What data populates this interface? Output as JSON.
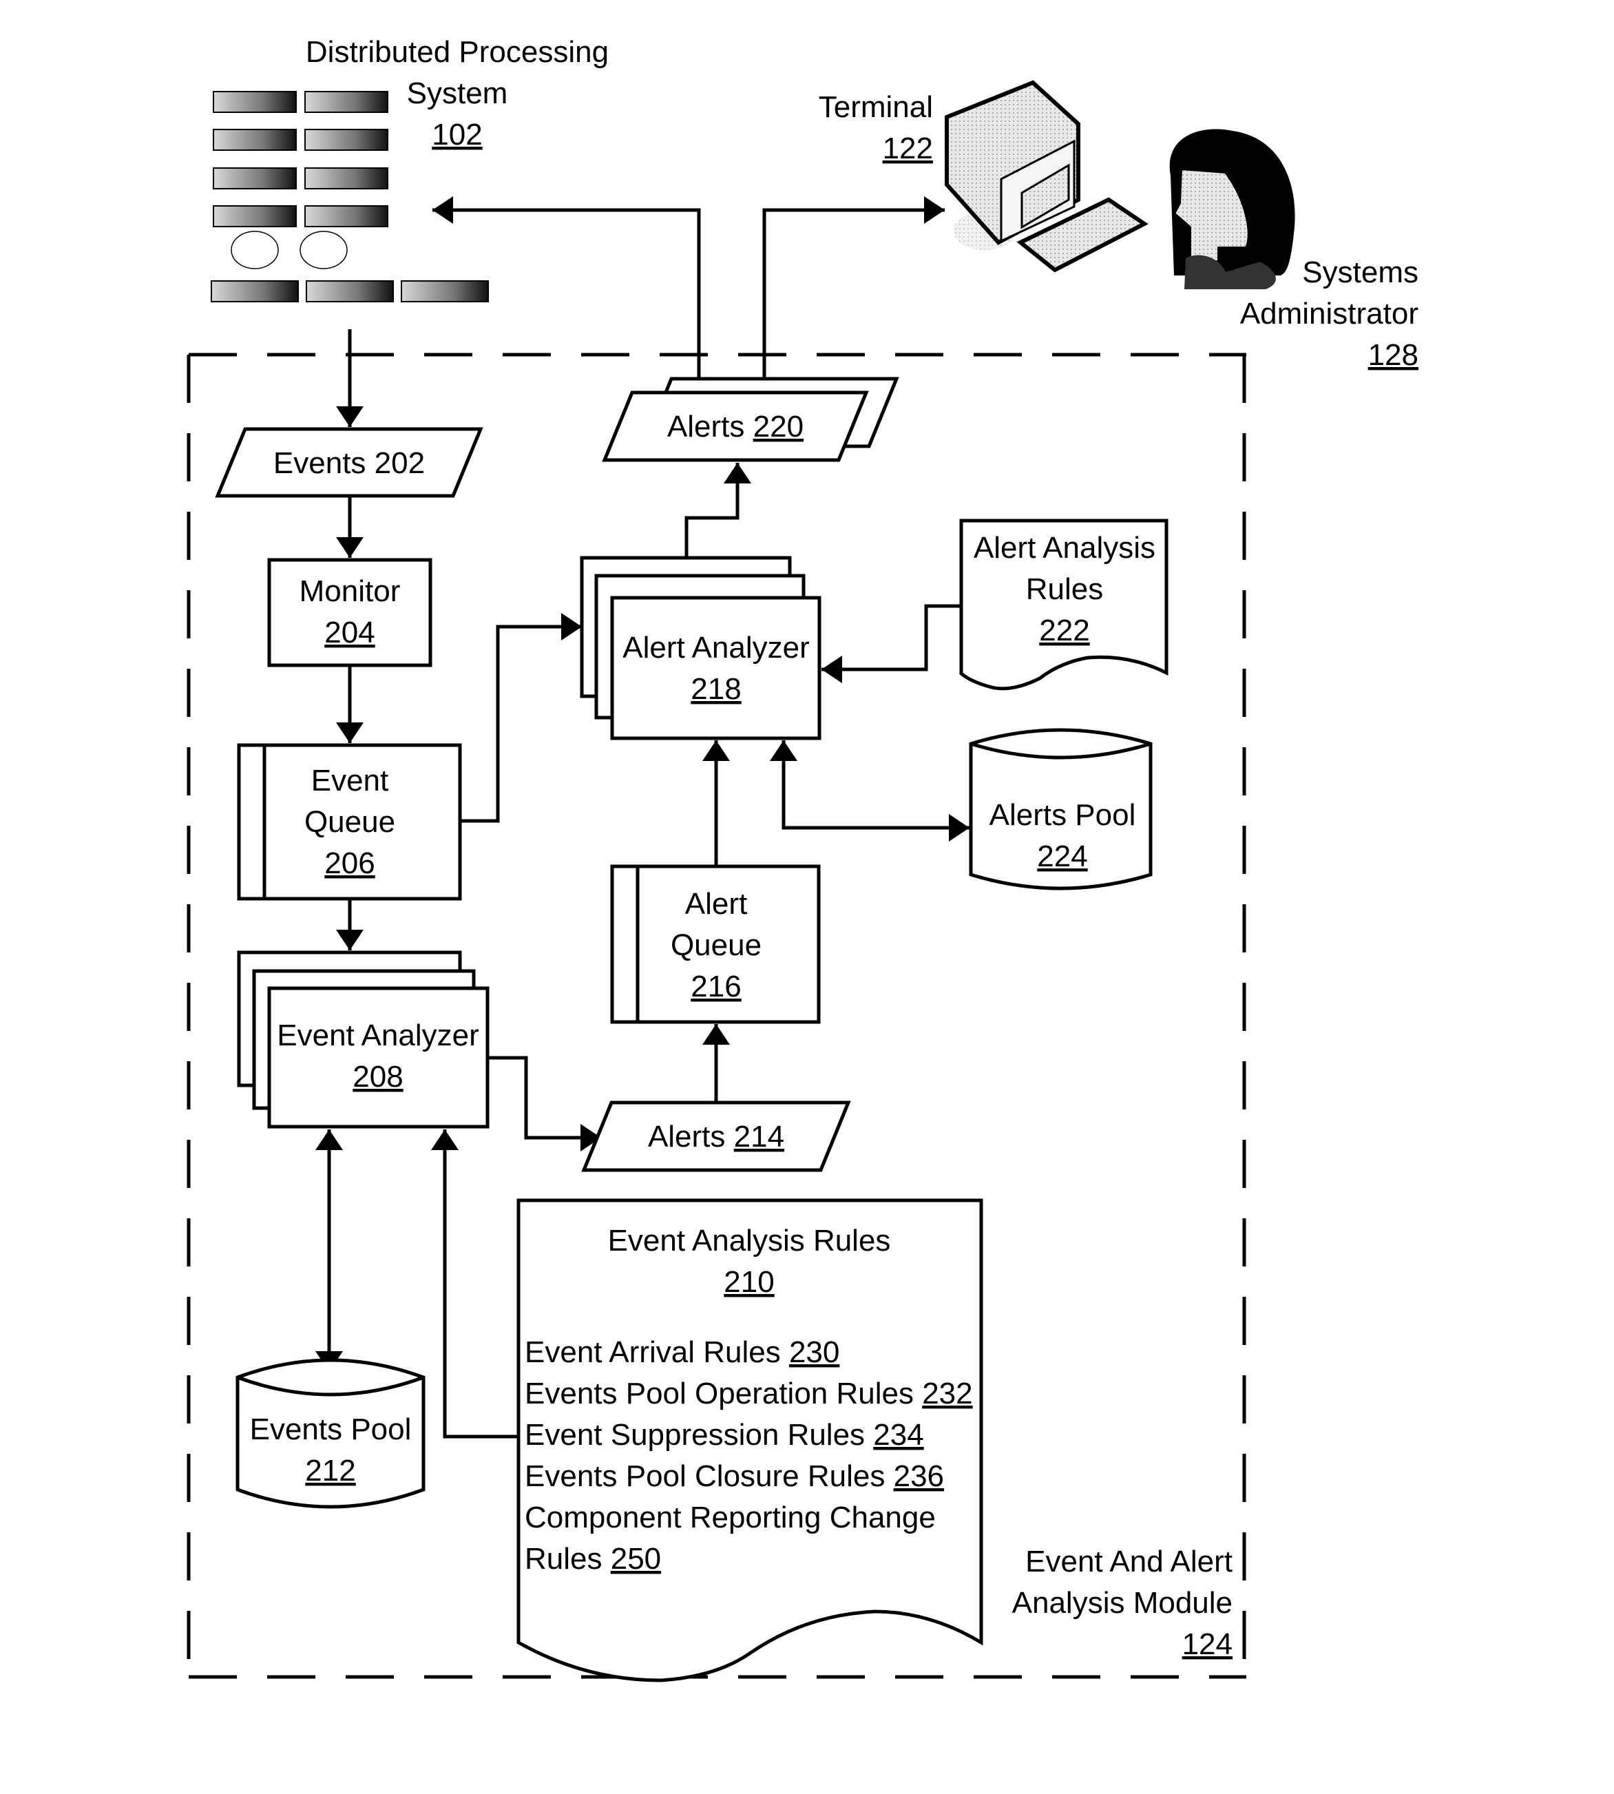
{
  "figure": {
    "distributed_system": {
      "line1": "Distributed Processing",
      "line2": "System",
      "ref": "102"
    },
    "terminal": {
      "line1": "Terminal",
      "ref": "122"
    },
    "admin": {
      "line1": "Systems",
      "line2": "Administrator",
      "ref": "128"
    },
    "module": {
      "line1": "Event And Alert",
      "line2": "Analysis Module",
      "ref": "124"
    },
    "events_202": {
      "label": "Events 202"
    },
    "monitor": {
      "line1": "Monitor",
      "ref": "204"
    },
    "event_queue": {
      "line1": "Event",
      "line2": "Queue",
      "ref": "206"
    },
    "event_analyzer": {
      "line1": "Event Analyzer",
      "ref": "208"
    },
    "events_pool": {
      "line1": "Events Pool",
      "ref": "212"
    },
    "alerts_214": {
      "label": "Alerts ",
      "ref": "214"
    },
    "alert_queue": {
      "line1": "Alert",
      "line2": "Queue",
      "ref": "216"
    },
    "alert_analyzer": {
      "line1": "Alert Analyzer",
      "ref": "218"
    },
    "alerts_220": {
      "label": "Alerts ",
      "ref": "220"
    },
    "alert_rules": {
      "line1": "Alert Analysis",
      "line2": "Rules",
      "ref": "222"
    },
    "alerts_pool": {
      "line1": "Alerts Pool",
      "ref": "224"
    },
    "event_rules": {
      "title": "Event Analysis Rules",
      "ref": "210",
      "items": [
        {
          "text": "Event Arrival Rules ",
          "ref": "230"
        },
        {
          "text": "Events Pool Operation Rules ",
          "ref": "232"
        },
        {
          "text": "Event Suppression Rules ",
          "ref": "234"
        },
        {
          "text": "Events Pool Closure Rules ",
          "ref": "236"
        },
        {
          "text": "Component Reporting Change",
          "ref": ""
        },
        {
          "text": "Rules ",
          "ref": "250"
        }
      ]
    }
  }
}
